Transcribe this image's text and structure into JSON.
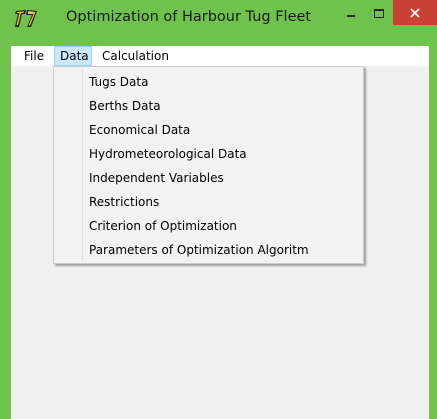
{
  "window": {
    "title": "Optimization of Harbour Tug Fleet",
    "accent_color": "#6fc24b",
    "close_color": "#c84134",
    "app_icon": "app-logo-icon",
    "controls": {
      "minimize_icon": "minimize-icon",
      "maximize_icon": "maximize-icon",
      "close_icon": "close-icon"
    }
  },
  "menubar": {
    "items": [
      {
        "label": "File"
      },
      {
        "label": "Data",
        "state": "open"
      },
      {
        "label": "Calculation"
      }
    ]
  },
  "data_menu": {
    "items": [
      {
        "label": "Tugs Data"
      },
      {
        "label": "Berths Data"
      },
      {
        "label": "Economical Data"
      },
      {
        "label": "Hydrometeorological Data"
      },
      {
        "label": "Independent Variables"
      },
      {
        "label": "Restrictions"
      },
      {
        "label": "Criterion of Optimization"
      },
      {
        "label": "Parameters of Optimization Algoritm"
      }
    ]
  }
}
